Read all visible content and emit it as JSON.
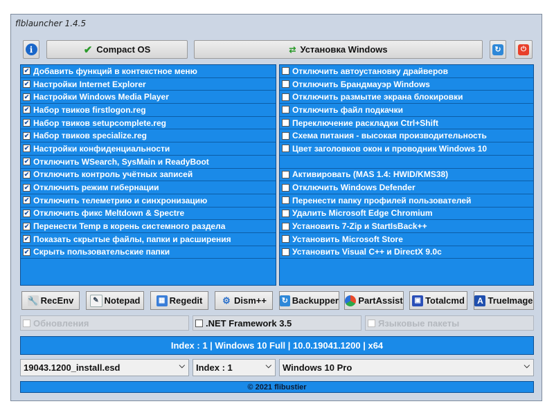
{
  "app": {
    "title": "flblauncher 1.4.5"
  },
  "toolbar": {
    "compact_label": "Compact OS",
    "install_label": "Установка Windows"
  },
  "left_options": [
    {
      "label": "Добавить функций в контекстное меню",
      "checked": true
    },
    {
      "label": "Настройки Internet Explorer",
      "checked": true
    },
    {
      "label": "Настройки Windows Media Player",
      "checked": true
    },
    {
      "label": "Набор твиков firstlogon.reg",
      "checked": true
    },
    {
      "label": "Набор твиков setupcomplete.reg",
      "checked": true
    },
    {
      "label": "Набор твиков specialize.reg",
      "checked": true
    },
    {
      "label": "Настройки конфиденциальности",
      "checked": true
    },
    {
      "label": "Отключить WSearch, SysMain и ReadyBoot",
      "checked": true
    },
    {
      "label": "Отключить контроль учётных записей",
      "checked": true
    },
    {
      "label": "Отключить режим гибернации",
      "checked": true
    },
    {
      "label": "Отключить телеметрию и синхронизацию",
      "checked": true
    },
    {
      "label": "Отключить фикс Meltdown & Spectre",
      "checked": true
    },
    {
      "label": "Перенести Temp в корень системного раздела",
      "checked": true
    },
    {
      "label": "Показать скрытые файлы, папки и расширения",
      "checked": true
    },
    {
      "label": "Скрыть пользовательские папки",
      "checked": true
    }
  ],
  "right_options": [
    {
      "label": "Отключить автоустановку драйверов",
      "checked": false
    },
    {
      "label": "Отключить Брандмауэр Windows",
      "checked": false
    },
    {
      "label": "Отключить размытие экрана блокировки",
      "checked": false
    },
    {
      "label": "Отключить файл подкачки",
      "checked": false
    },
    {
      "label": "Переключение раскладки Ctrl+Shift",
      "checked": false
    },
    {
      "label": "Схема питания - высокая производительность",
      "checked": false
    },
    {
      "label": "Цвет заголовков окон и проводник Windows 10",
      "checked": false
    },
    {
      "label": "",
      "checked": null
    },
    {
      "label": "Активировать (MAS 1.4: HWID/KMS38)",
      "checked": false
    },
    {
      "label": "Отключить Windows Defender",
      "checked": false
    },
    {
      "label": "Перенести папку профилей пользователей",
      "checked": false
    },
    {
      "label": "Удалить Microsoft Edge Chromium",
      "checked": false
    },
    {
      "label": "Установить 7-Zip и StartIsBack++",
      "checked": false
    },
    {
      "label": "Установить Microsoft Store",
      "checked": false
    },
    {
      "label": "Установить Visual C++ и DirectX 9.0c",
      "checked": false
    }
  ],
  "tools": {
    "recenv": "RecEnv",
    "notepad": "Notepad",
    "regedit": "Regedit",
    "dism": "Dism++",
    "backupper": "Backupper",
    "partassist": "PartAssist",
    "totalcmd": "Totalcmd",
    "trueimage": "TrueImage"
  },
  "extra_options": {
    "updates": "Обновления",
    "netfx": ".NET Framework 3.5",
    "langpacks": "Языковые пакеты"
  },
  "status": {
    "text": "Index : 1 | Windows 10 Full | 10.0.19041.1200 | x64"
  },
  "selects": {
    "image": "19043.1200_install.esd",
    "index": "Index : 1",
    "edition": "Windows 10 Pro"
  },
  "footer": {
    "text": "© 2021 flibustier"
  },
  "colors": {
    "panel": "#1a8ae8",
    "window": "#ccd6e4",
    "check": "#2a9a2a",
    "power": "#e8402a"
  },
  "icons": {
    "info": "info-icon",
    "check": "check-icon",
    "install": "install-icon",
    "refresh": "refresh-icon",
    "power": "power-icon"
  }
}
